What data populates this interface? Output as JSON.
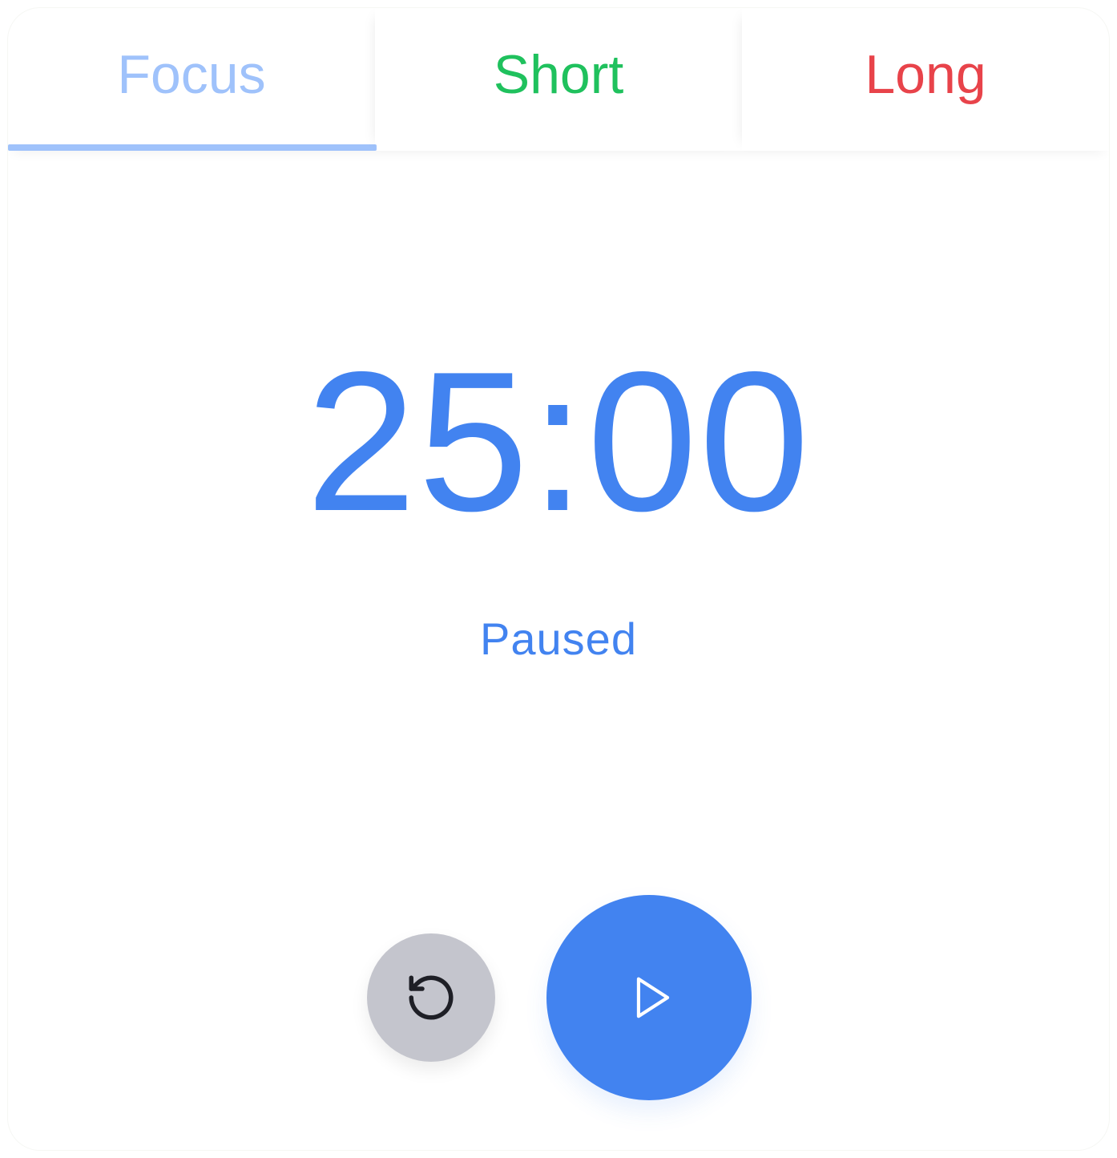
{
  "tabs": [
    {
      "label": "Focus",
      "color": "#9fc2fb",
      "selected": true
    },
    {
      "label": "Short",
      "color": "#1fc15d",
      "selected": false
    },
    {
      "label": "Long",
      "color": "#e8434a",
      "selected": false
    }
  ],
  "timer": {
    "display": "25:00",
    "status": "Paused",
    "color": "#4283f0"
  },
  "controls": {
    "reset_icon": "reset-icon",
    "play_icon": "play-icon",
    "reset_color": "#c4c5cd",
    "play_color": "#4283f0"
  }
}
